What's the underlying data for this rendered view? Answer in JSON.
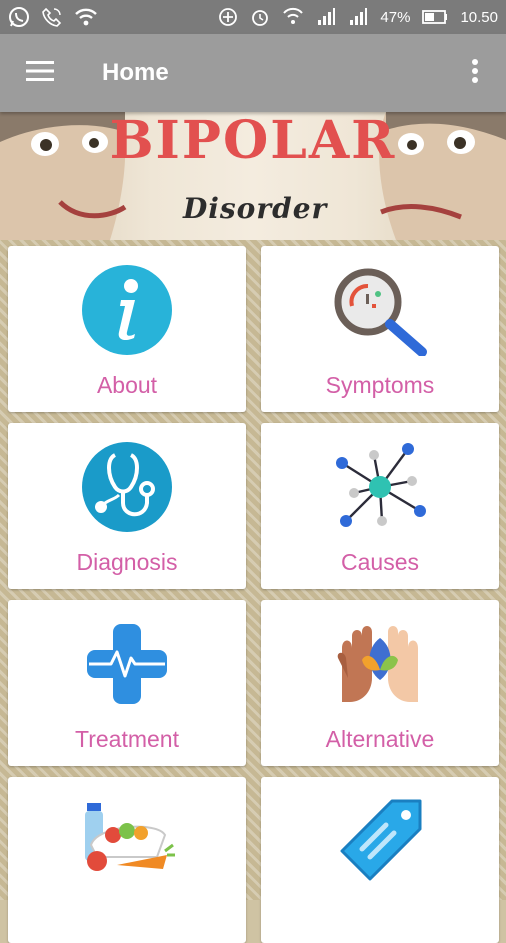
{
  "status_bar": {
    "battery_percent": "47%",
    "time": "10.50",
    "icons": [
      "whatsapp-icon",
      "call-icon",
      "wifi-icon",
      "data-saver-icon",
      "alarm-icon",
      "wifi-call-icon",
      "signal-icon",
      "signal-icon",
      "battery-icon"
    ]
  },
  "app_bar": {
    "title": "Home",
    "menu_icon": "hamburger-menu-icon",
    "overflow_icon": "more-vert-icon"
  },
  "banner": {
    "title": "BIPOLAR",
    "subtitle": "Disorder",
    "title_color": "#e2504f"
  },
  "menu_items": [
    {
      "label": "About",
      "icon": "info-icon"
    },
    {
      "label": "Symptoms",
      "icon": "magnifier-icon"
    },
    {
      "label": "Diagnosis",
      "icon": "stethoscope-icon"
    },
    {
      "label": "Causes",
      "icon": "network-icon"
    },
    {
      "label": "Treatment",
      "icon": "medical-cross-icon"
    },
    {
      "label": "Alternative",
      "icon": "hands-leaf-icon"
    },
    {
      "label": "",
      "icon": "food-icon"
    },
    {
      "label": "",
      "icon": "tag-icon"
    }
  ],
  "colors": {
    "label": "#d35fa7",
    "app_bar": "#9c9c9c",
    "status_bar": "#7b7b7b"
  }
}
